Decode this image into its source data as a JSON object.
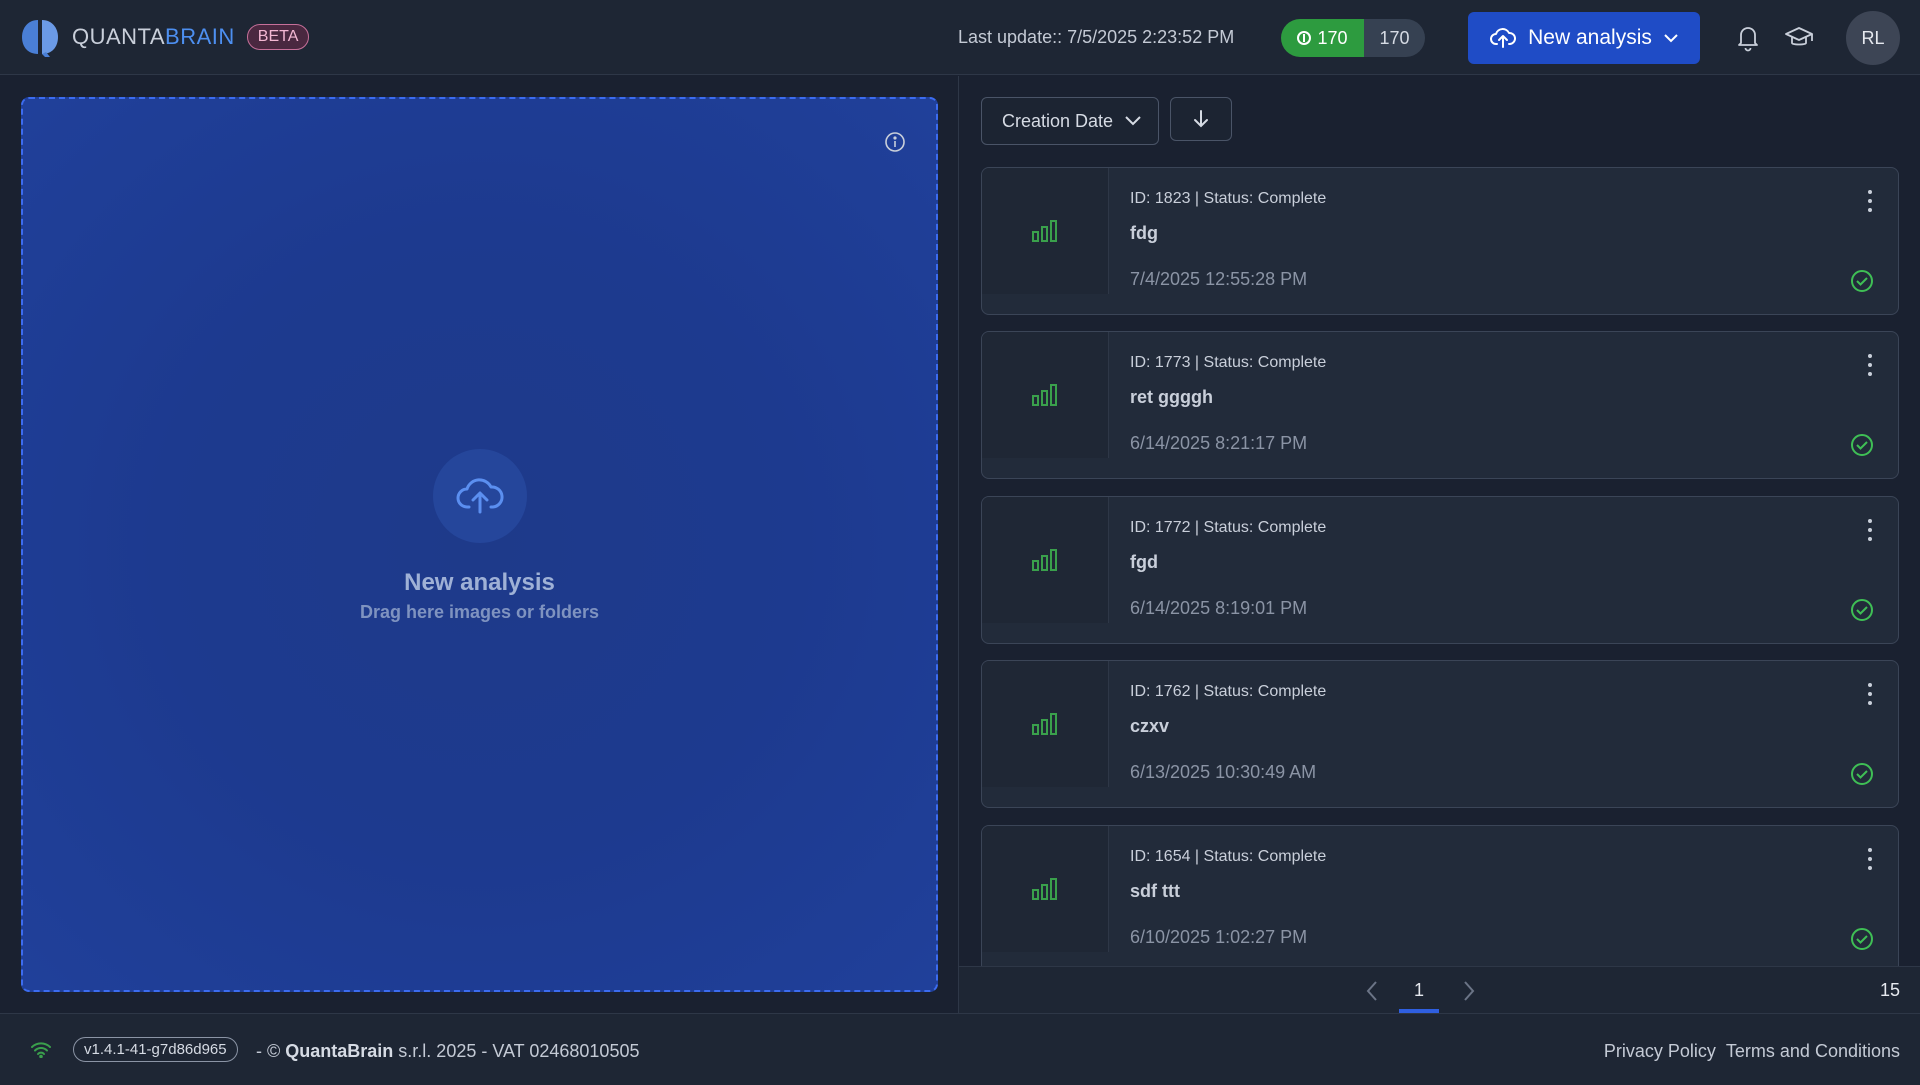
{
  "header": {
    "logo_prefix": "QUANTA",
    "logo_suffix": "BRAIN",
    "beta_label": "BETA",
    "last_update": "Last update:: 7/5/2025 2:23:52 PM",
    "credits_used": "170",
    "credits_total": "170",
    "new_analysis_label": "New analysis",
    "avatar_initials": "RL"
  },
  "dropzone": {
    "title": "New analysis",
    "subtitle": "Drag here images or folders"
  },
  "sort": {
    "field_label": "Creation Date"
  },
  "analyses": [
    {
      "meta": "ID: 1823 | Status: Complete",
      "name": "fdg",
      "date": "7/4/2025 12:55:28 PM"
    },
    {
      "meta": "ID: 1773 | Status: Complete",
      "name": "ret ggggh",
      "date": "6/14/2025 8:21:17 PM"
    },
    {
      "meta": "ID: 1772 | Status: Complete",
      "name": "fgd",
      "date": "6/14/2025 8:19:01 PM"
    },
    {
      "meta": "ID: 1762 | Status: Complete",
      "name": "czxv",
      "date": "6/13/2025 10:30:49 AM"
    },
    {
      "meta": "ID: 1654 | Status: Complete",
      "name": "sdf ttt",
      "date": "6/10/2025 1:02:27 PM"
    }
  ],
  "pagination": {
    "current_page": "1",
    "total": "15"
  },
  "footer": {
    "version": "v1.4.1-41-g7d86d965",
    "copyright_prefix": "- © ",
    "company": "QuantaBrain",
    "copyright_suffix": " s.r.l. 2025 - VAT 02468010505",
    "privacy_label": "Privacy Policy",
    "terms_label": "Terms and Conditions"
  },
  "colors": {
    "accent": "#1f4cc6",
    "success": "#2d9b3f",
    "background": "#1a2130",
    "dropzone": "#1e3a8a"
  },
  "icons": [
    "brain-logo-icon",
    "coin-icon",
    "cloud-upload-icon",
    "chevron-down-icon",
    "bell-icon",
    "graduation-cap-icon",
    "info-icon",
    "arrow-down-icon",
    "bar-chart-icon",
    "kebab-menu-icon",
    "check-circle-icon",
    "chevron-left-icon",
    "chevron-right-icon",
    "wifi-icon"
  ]
}
